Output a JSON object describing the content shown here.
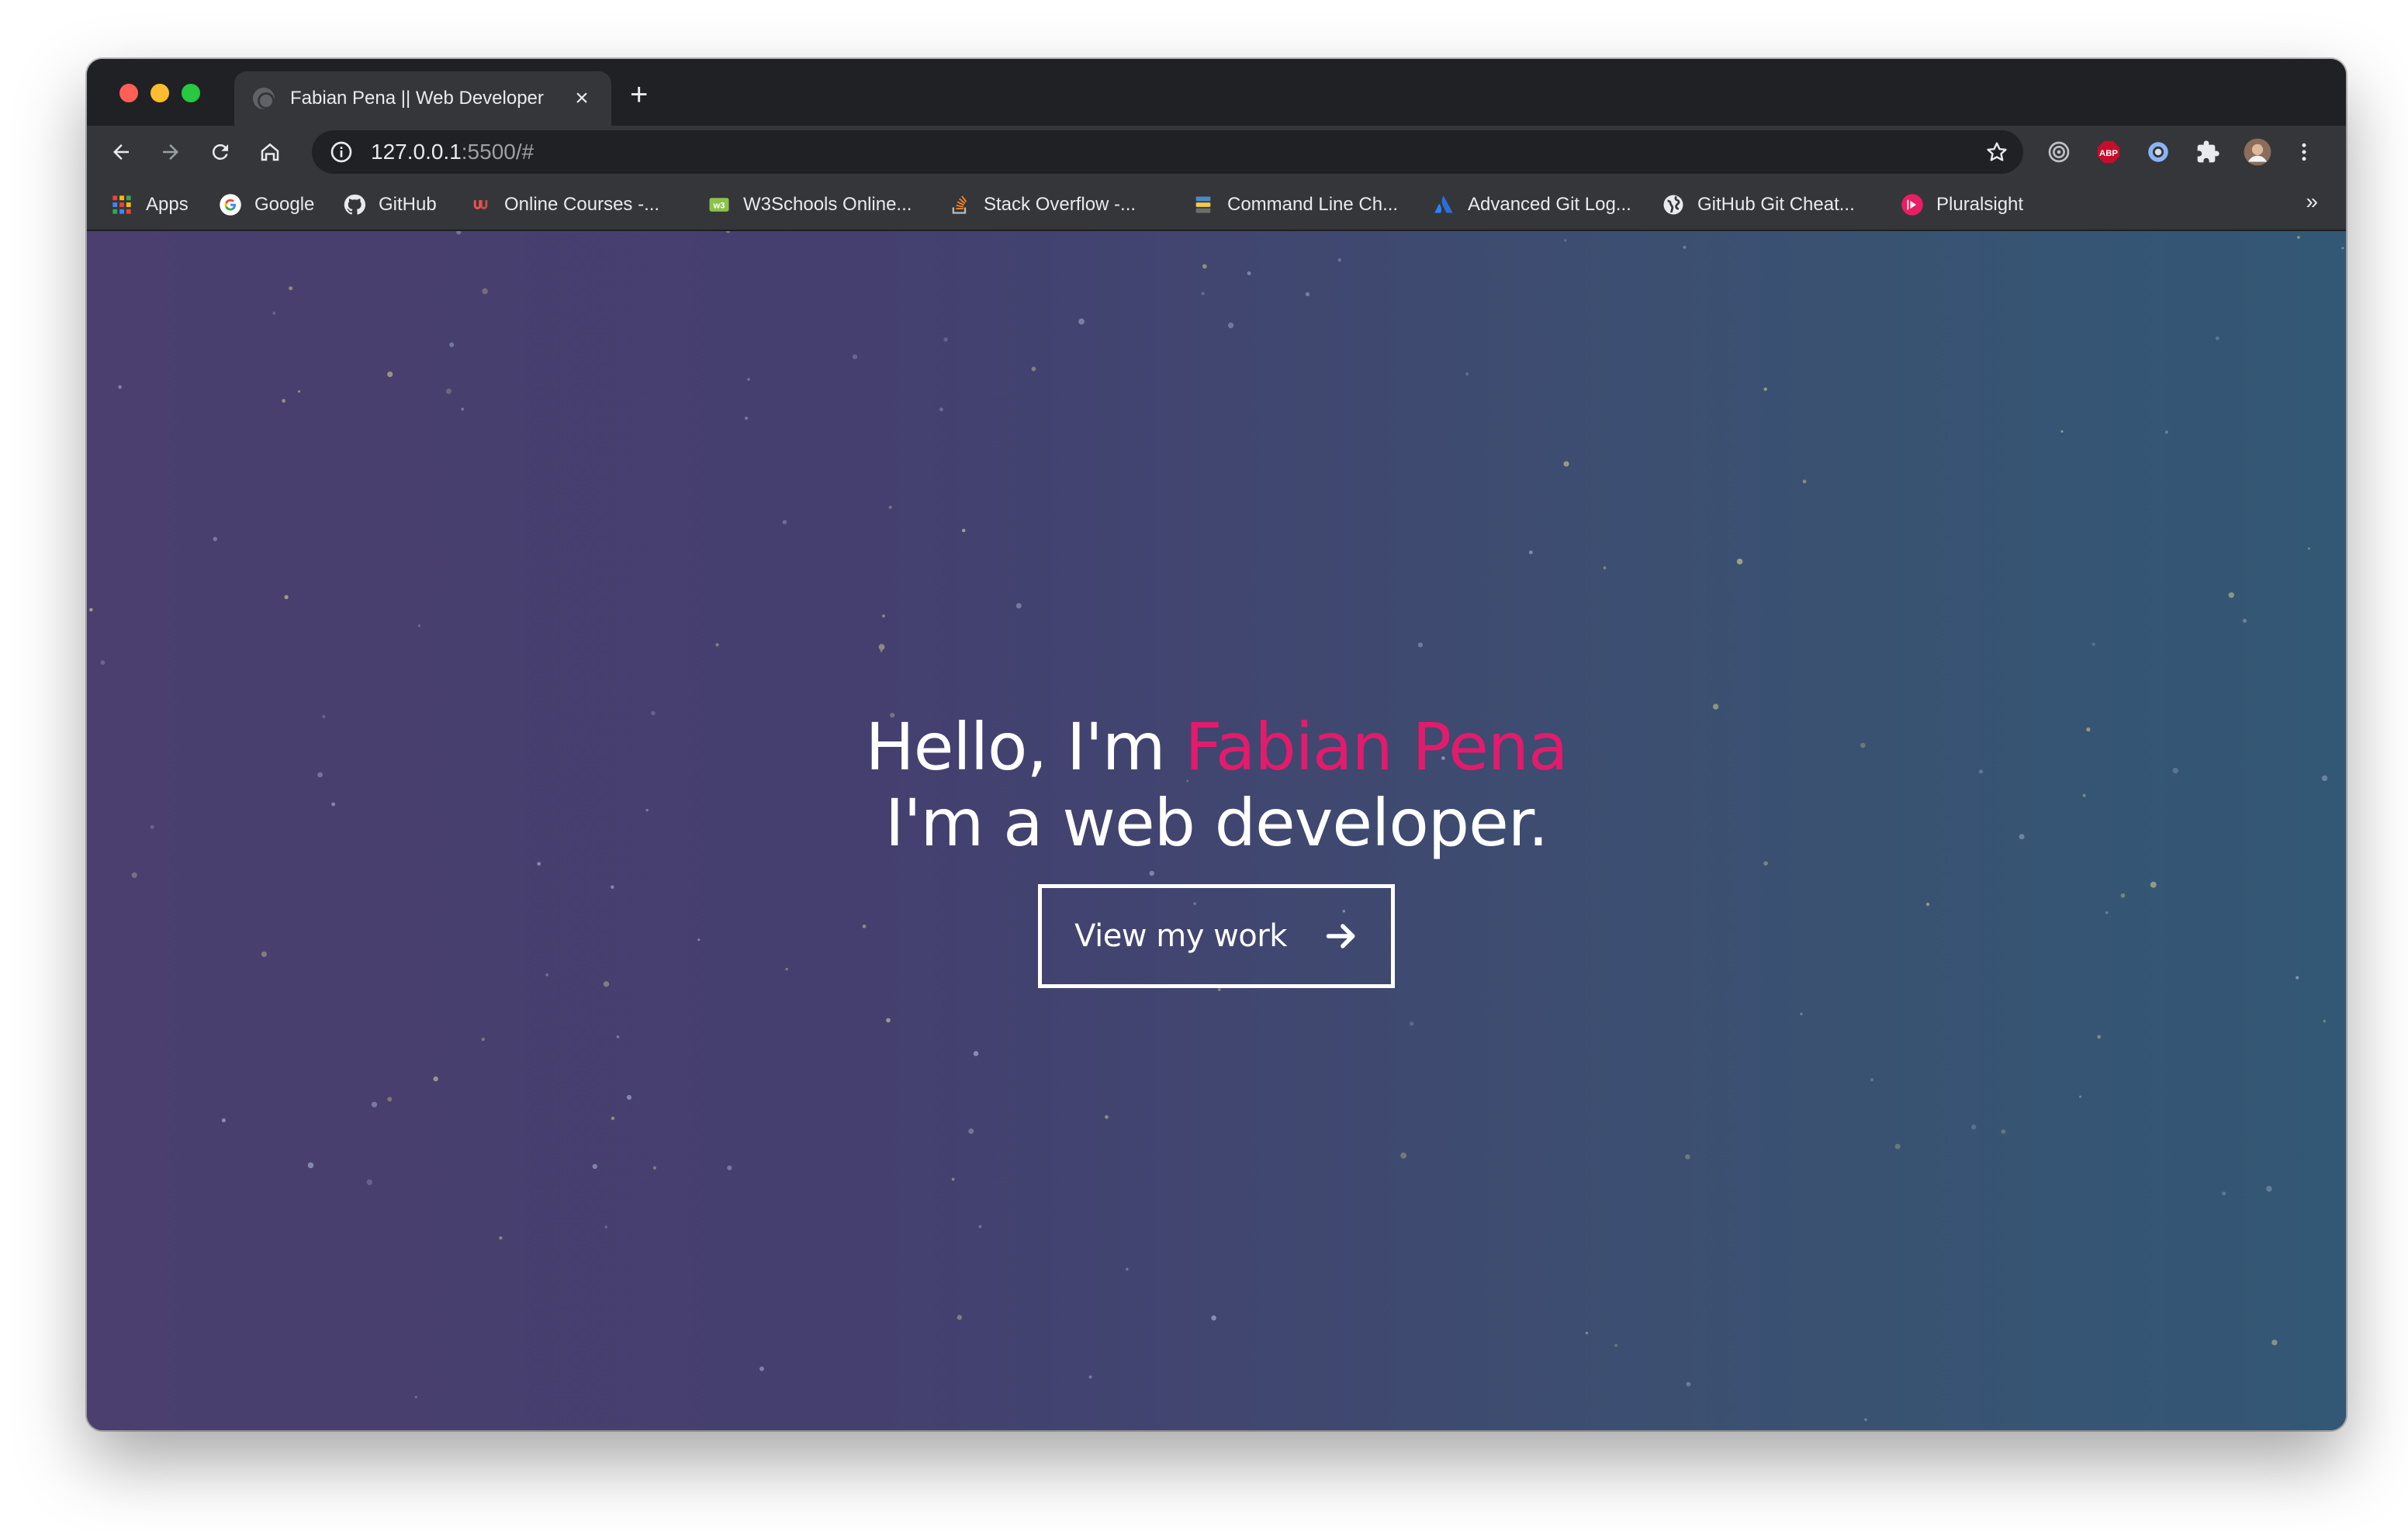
{
  "browser": {
    "tab": {
      "title": "Fabian Pena || Web Developer",
      "close_glyph": "×"
    },
    "new_tab_glyph": "+",
    "url": {
      "host": "127.0.0.1",
      "rest": ":5500/#"
    },
    "bookmarks": [
      {
        "label": "Apps",
        "icon": "apps-grid-icon"
      },
      {
        "label": "Google",
        "icon": "google-icon"
      },
      {
        "label": "GitHub",
        "icon": "github-icon"
      },
      {
        "label": "Online Courses -...",
        "icon": "udemy-icon"
      },
      {
        "label": "W3Schools Online...",
        "icon": "w3schools-icon"
      },
      {
        "label": "Stack Overflow -...",
        "icon": "stackoverflow-icon"
      },
      {
        "label": "Command Line Ch...",
        "icon": "command-line-icon"
      },
      {
        "label": "Advanced Git Log...",
        "icon": "atlassian-icon"
      },
      {
        "label": "GitHub Git Cheat...",
        "icon": "globe-icon"
      },
      {
        "label": "Pluralsight",
        "icon": "pluralsight-icon"
      }
    ],
    "bookmarks_more_glyph": "»",
    "extensions": [
      "target-extension-icon",
      "adblock-plus-icon",
      "circle-extension-icon",
      "puzzle-extensions-icon",
      "profile-avatar",
      "menu-kebab-icon"
    ],
    "adblock_label": "ABP"
  },
  "page": {
    "hero": {
      "greeting": "Hello, I'm ",
      "name": "Fabian Pena",
      "tagline": "I'm a web developer."
    },
    "cta": {
      "label": "View my work"
    },
    "colors": {
      "highlight": "#e31b6d",
      "gradient_start": "#4a3f6e",
      "gradient_end": "#325875"
    }
  }
}
